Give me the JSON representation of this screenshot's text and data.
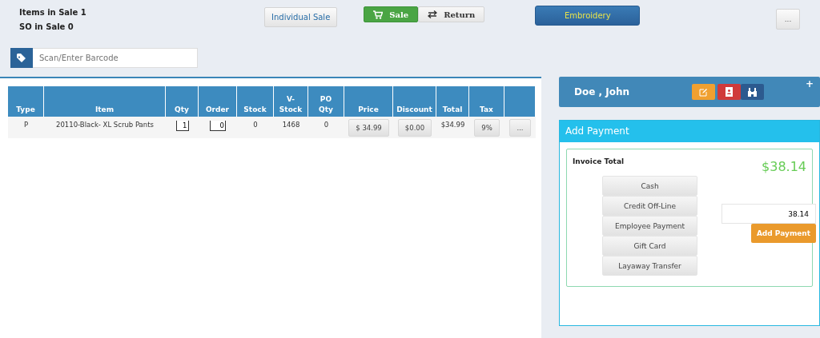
{
  "summary": [
    "Items in Sale 1",
    "SO in Sale 0"
  ],
  "sale_type": {
    "label": "Individual Sale"
  },
  "modes": [
    {
      "label": "Sale",
      "kind": "sale",
      "selected": true
    },
    {
      "label": "Return",
      "kind": "return",
      "selected": false
    }
  ],
  "embroidery": {
    "label": "Embroidery"
  },
  "more_button": {
    "label": "..."
  },
  "barcode": {
    "placeholder": "Scan/Enter Barcode"
  },
  "table": {
    "columns": [
      "Type",
      "Item",
      "Qty",
      "Order",
      "Stock",
      "V-\nStock",
      "PO\nQty",
      "Price",
      "Discount",
      "Total",
      "Tax",
      ""
    ],
    "rows": [
      {
        "type": "P",
        "item": "20110-Black- XL Scrub Pants",
        "qty": "1",
        "order": "0",
        "stock": "0",
        "v_stock": "1468",
        "po_qty": "0",
        "price": "$ 34.99",
        "discount": "$0.00",
        "total": "$34.99",
        "tax": "9%",
        "more": "..."
      }
    ]
  },
  "customer": {
    "name": "Doe , John",
    "add": "+"
  },
  "payment": {
    "title": "Add Payment",
    "invoice_label": "Invoice Total",
    "invoice_total": "$38.14",
    "methods": [
      "Cash",
      "Credit Off-Line",
      "Employee Payment",
      "Gift Card",
      "Layaway Transfer"
    ],
    "amount": "38.14",
    "submit": "Add Payment"
  }
}
